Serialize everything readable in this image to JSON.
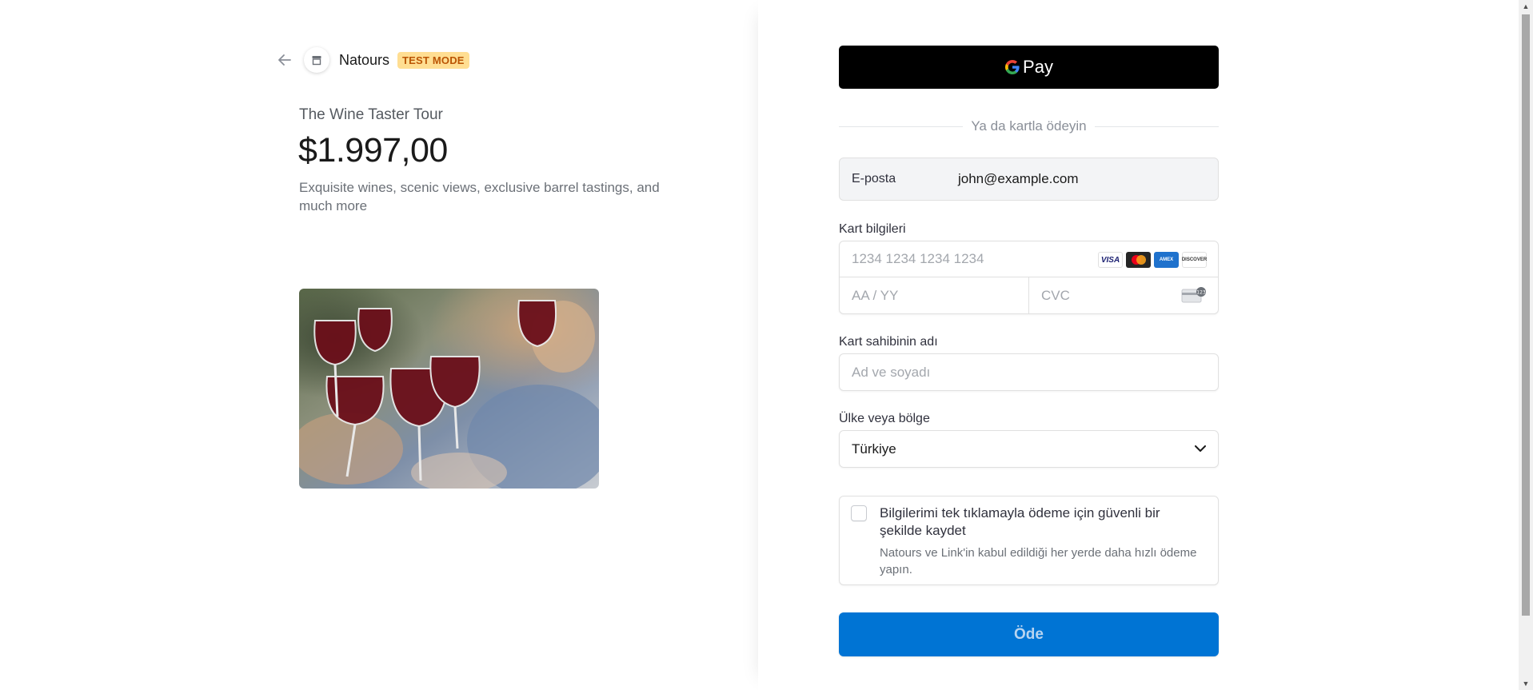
{
  "header": {
    "merchant_name": "Natours",
    "test_badge": "TEST MODE"
  },
  "product": {
    "name": "The Wine Taster Tour",
    "price": "$1.997,00",
    "description": "Exquisite wines, scenic views, exclusive barrel tastings, and much more"
  },
  "gpay": {
    "label": "Pay"
  },
  "divider": {
    "text": "Ya da kartla ödeyin"
  },
  "email": {
    "label": "E-posta",
    "value": "john@example.com"
  },
  "card": {
    "label": "Kart bilgileri",
    "number_placeholder": "1234 1234 1234 1234",
    "expiry_placeholder": "AA / YY",
    "cvc_placeholder": "CVC",
    "brands": [
      "VISA",
      "Mastercard",
      "AMEX",
      "DISCOVER"
    ]
  },
  "cardholder": {
    "label": "Kart sahibinin adı",
    "placeholder": "Ad ve soyadı"
  },
  "country": {
    "label": "Ülke veya bölge",
    "value": "Türkiye"
  },
  "save": {
    "title": "Bilgilerimi tek tıklamayla ödeme için güvenli bir şekilde kaydet",
    "subtitle": "Natours ve Link'in kabul edildiği her yerde daha hızlı ödeme yapın."
  },
  "pay_button": {
    "label": "Öde"
  },
  "colors": {
    "pay_button": "#0074d4",
    "test_badge_bg": "#ffde92",
    "test_badge_text": "#bb5504",
    "gpay_bg": "#000000"
  }
}
